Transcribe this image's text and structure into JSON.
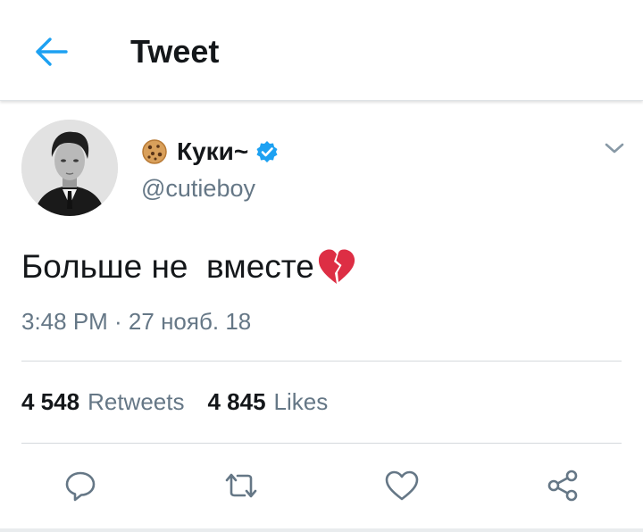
{
  "header": {
    "title": "Tweet",
    "back_icon": "arrow-left-icon",
    "accent": "#1da1f2"
  },
  "tweet": {
    "name": "Куки~",
    "name_emoji": "cookie-icon",
    "verified_icon": "verified-badge-icon",
    "handle": "@cutieboy",
    "text": "Больше не  вместе",
    "text_emoji": "broken-heart-icon",
    "timestamp": "3:48 PM · 27 нояб. 18",
    "retweets_count": "4 548",
    "retweets_label": "Retweets",
    "likes_count": "4 845",
    "likes_label": "Likes"
  },
  "actions": [
    "reply-icon",
    "retweet-icon",
    "like-icon",
    "share-icon"
  ],
  "colors": {
    "secondary_text": "#657786",
    "primary_text": "#14171a",
    "icon": "#657786"
  }
}
